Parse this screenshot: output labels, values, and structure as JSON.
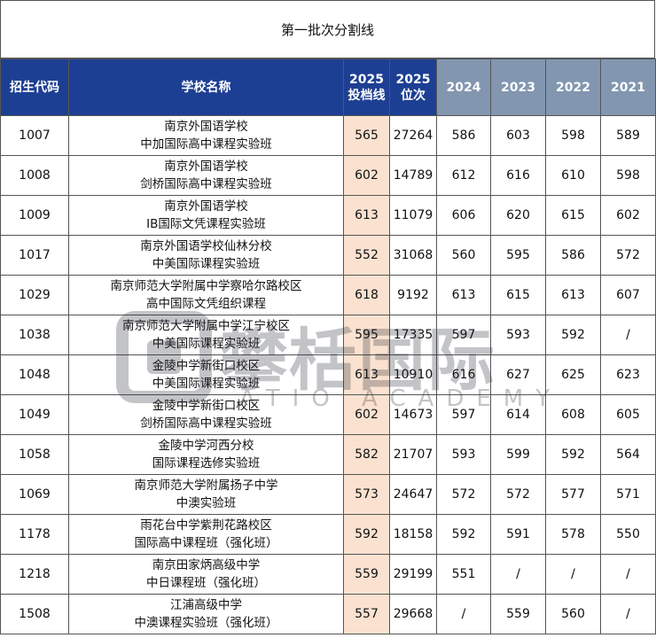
{
  "title": "第一批次分割线",
  "headers": {
    "code": "招生代码",
    "name": "学校名称",
    "score_2025_year": "2025",
    "score_2025_label": "投档线",
    "rank_2025_year": "2025",
    "rank_2025_label": "位次",
    "y2024": "2024",
    "y2023": "2023",
    "y2022": "2022",
    "y2021": "2021"
  },
  "rows": [
    {
      "code": "1007",
      "name1": "南京外国语学校",
      "name2": "中加国际高中课程实验班",
      "score": "565",
      "rank": "27264",
      "y2024": "586",
      "y2023": "603",
      "y2022": "598",
      "y2021": "589"
    },
    {
      "code": "1008",
      "name1": "南京外国语学校",
      "name2": "剑桥国际高中课程实验班",
      "score": "602",
      "rank": "14789",
      "y2024": "612",
      "y2023": "616",
      "y2022": "610",
      "y2021": "598"
    },
    {
      "code": "1009",
      "name1": "南京外国语学校",
      "name2": "IB国际文凭课程实验班",
      "score": "613",
      "rank": "11079",
      "y2024": "606",
      "y2023": "620",
      "y2022": "615",
      "y2021": "602"
    },
    {
      "code": "1017",
      "name1": "南京外国语学校仙林分校",
      "name2": "中美国际课程实验班",
      "score": "552",
      "rank": "31068",
      "y2024": "560",
      "y2023": "595",
      "y2022": "586",
      "y2021": "572"
    },
    {
      "code": "1029",
      "name1": "南京师范大学附属中学察哈尔路校区",
      "name2": "高中国际文凭组织课程",
      "score": "618",
      "rank": "9192",
      "y2024": "613",
      "y2023": "615",
      "y2022": "613",
      "y2021": "607"
    },
    {
      "code": "1038",
      "name1": "南京师范大学附属中学江宁校区",
      "name2": "中美国际课程实验班",
      "score": "595",
      "rank": "17335",
      "y2024": "597",
      "y2023": "593",
      "y2022": "592",
      "y2021": "/"
    },
    {
      "code": "1048",
      "name1": "金陵中学新街口校区",
      "name2": "中美国际课程实验班",
      "score": "613",
      "rank": "10910",
      "y2024": "616",
      "y2023": "627",
      "y2022": "625",
      "y2021": "623"
    },
    {
      "code": "1049",
      "name1": "金陵中学新街口校区",
      "name2": "剑桥国际高中课程实验班",
      "score": "602",
      "rank": "14673",
      "y2024": "597",
      "y2023": "614",
      "y2022": "608",
      "y2021": "605"
    },
    {
      "code": "1058",
      "name1": "金陵中学河西分校",
      "name2": "国际课程选修实验班",
      "score": "582",
      "rank": "21707",
      "y2024": "593",
      "y2023": "599",
      "y2022": "592",
      "y2021": "564"
    },
    {
      "code": "1069",
      "name1": "南京师范大学附属扬子中学",
      "name2": "中澳实验班",
      "score": "573",
      "rank": "24647",
      "y2024": "572",
      "y2023": "572",
      "y2022": "577",
      "y2021": "571"
    },
    {
      "code": "1178",
      "name1": "雨花台中学紫荆花路校区",
      "name2": "国际高中课程班（强化班）",
      "score": "592",
      "rank": "18158",
      "y2024": "592",
      "y2023": "591",
      "y2022": "578",
      "y2021": "550"
    },
    {
      "code": "1218",
      "name1": "南京田家炳高级中学",
      "name2": "中日课程班（强化班）",
      "score": "559",
      "rank": "29199",
      "y2024": "551",
      "y2023": "/",
      "y2022": "/",
      "y2021": "/"
    },
    {
      "code": "1508",
      "name1": "江浦高级中学",
      "name2": "中澳课程实验班（强化班）",
      "score": "557",
      "rank": "29668",
      "y2024": "/",
      "y2023": "559",
      "y2022": "560",
      "y2021": "/"
    }
  ],
  "watermark": {
    "text": "攀栝国际",
    "subtext": "ATIO ACADEMY"
  },
  "colors": {
    "header_current": "#1d3f93",
    "header_past": "#8296b0",
    "score_highlight": "#fbe2d0"
  }
}
